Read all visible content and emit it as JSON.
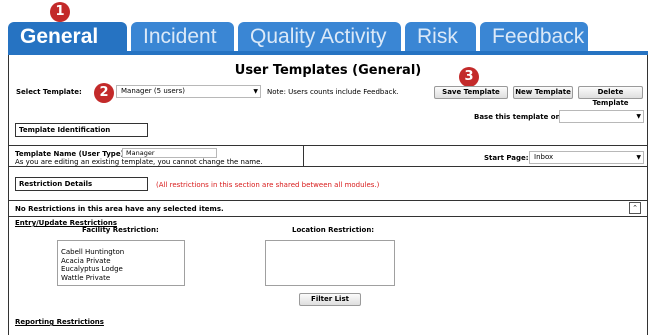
{
  "tabs": [
    {
      "label": "General",
      "active": true
    },
    {
      "label": "Incident",
      "active": false
    },
    {
      "label": "Quality Activity",
      "active": false
    },
    {
      "label": "Risk",
      "active": false
    },
    {
      "label": "Feedback",
      "active": false
    }
  ],
  "badges": {
    "one": "1",
    "two": "2",
    "three": "3"
  },
  "page_title": "User Templates (General)",
  "select_template": {
    "label": "Select Template:",
    "value": "Manager (5 users)",
    "note": "Note: Users counts include Feedback."
  },
  "toolbar": {
    "save": "Save Template",
    "new": "New Template",
    "delete": "Delete Template"
  },
  "base_template": {
    "label": "Base this template on:",
    "value": ""
  },
  "template_identification": {
    "label": "Template Identification"
  },
  "template_name": {
    "label": "Template Name (User Type):",
    "value": "Manager",
    "hint": "As you are editing an existing template, you cannot change the name."
  },
  "start_page": {
    "label": "Start Page:",
    "value": "Inbox"
  },
  "restriction_details": {
    "label": "Restriction Details",
    "note": "(All restrictions in this section are shared between all modules.)"
  },
  "no_restrictions": "No Restrictions in this area have any selected items.",
  "entry_update": {
    "label": "Entry/Update Restrictions"
  },
  "facility_restriction": {
    "label": "Facility Restriction:",
    "items": [
      "Cabell Huntington",
      "Acacia Private",
      "Eucalyptus Lodge",
      "Wattle Private"
    ]
  },
  "location_restriction": {
    "label": "Location Restriction:",
    "items": []
  },
  "filter_list": "Filter List",
  "reporting_restrictions": "Reporting Restrictions",
  "colors": {
    "tab_active": "#2673c2",
    "tab_inactive": "#3a86d4",
    "badge": "#c32a2a",
    "note_red": "#d81b1b"
  },
  "icons": {
    "collapse": "chevron-double-up-icon",
    "dropdown": "caret-down-icon"
  }
}
